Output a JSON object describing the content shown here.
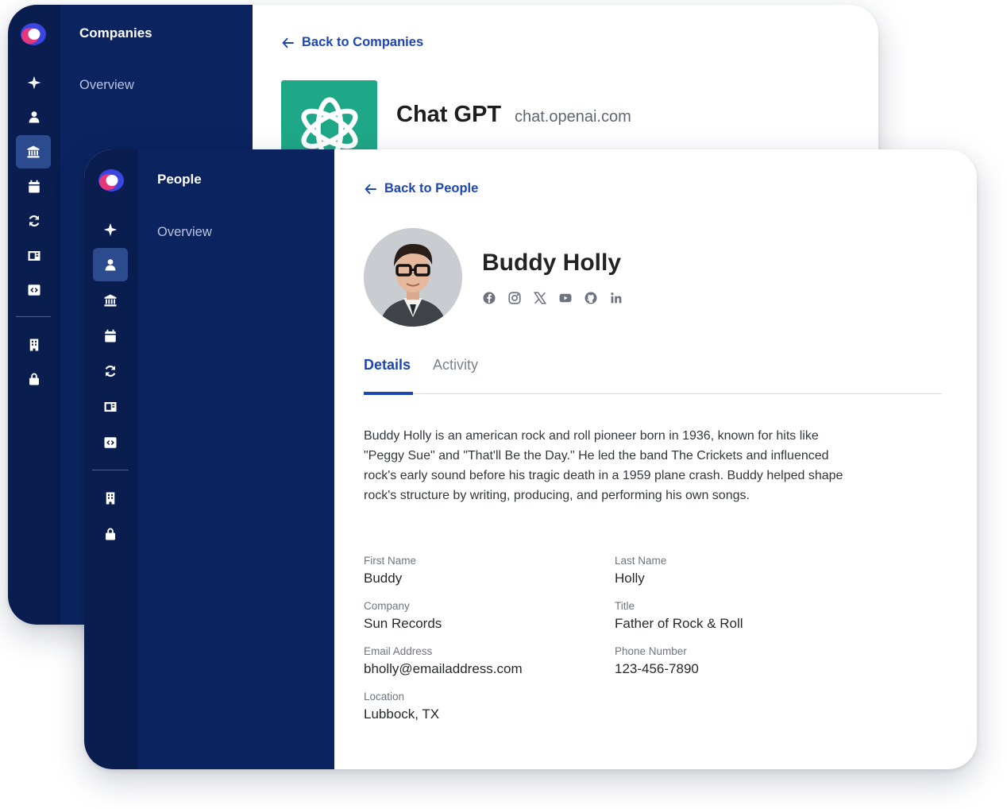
{
  "companies_window": {
    "panel_title": "Companies",
    "nav_items": [
      {
        "label": "Overview"
      }
    ],
    "back_link": "Back to Companies",
    "company": {
      "name": "Chat GPT",
      "domain": "chat.openai.com",
      "logo_icon": "openai-logo-icon",
      "logo_color": "#1fa888"
    }
  },
  "people_window": {
    "panel_title": "People",
    "nav_items": [
      {
        "label": "Overview"
      }
    ],
    "back_link": "Back to People",
    "person": {
      "name": "Buddy Holly",
      "avatar": "person-photo",
      "socials": [
        "facebook-icon",
        "instagram-icon",
        "x-icon",
        "youtube-icon",
        "github-icon",
        "linkedin-icon"
      ]
    },
    "tabs": [
      {
        "label": "Details",
        "active": true
      },
      {
        "label": "Activity",
        "active": false
      }
    ],
    "bio": "Buddy Holly is an american rock and roll pioneer born in 1936, known for hits like \"Peggy Sue\" and \"That'll Be the Day.\" He led the band The Crickets and influenced rock's early sound before his tragic death in a 1959 plane crash. Buddy helped shape rock's structure by writing, producing, and performing his own songs.",
    "fields": {
      "first_name": {
        "label": "First Name",
        "value": "Buddy"
      },
      "last_name": {
        "label": "Last Name",
        "value": "Holly"
      },
      "company": {
        "label": "Company",
        "value": "Sun Records"
      },
      "title": {
        "label": "Title",
        "value": "Father of Rock & Roll"
      },
      "email": {
        "label": "Email Address",
        "value": "bholly@emailaddress.com"
      },
      "phone": {
        "label": "Phone Number",
        "value": "123-456-7890"
      },
      "location": {
        "label": "Location",
        "value": "Lubbock, TX"
      }
    }
  },
  "rail_icons": [
    "sparkle-icon",
    "person-icon",
    "bank-icon",
    "calendar-icon",
    "sync-icon",
    "panel-icon",
    "code-icon",
    "building-icon",
    "lock-icon"
  ],
  "colors": {
    "rail": "#0a1d4f",
    "panel": "#0b2460",
    "rail_active": "#2c4b8f",
    "accent": "#1c46b5"
  }
}
